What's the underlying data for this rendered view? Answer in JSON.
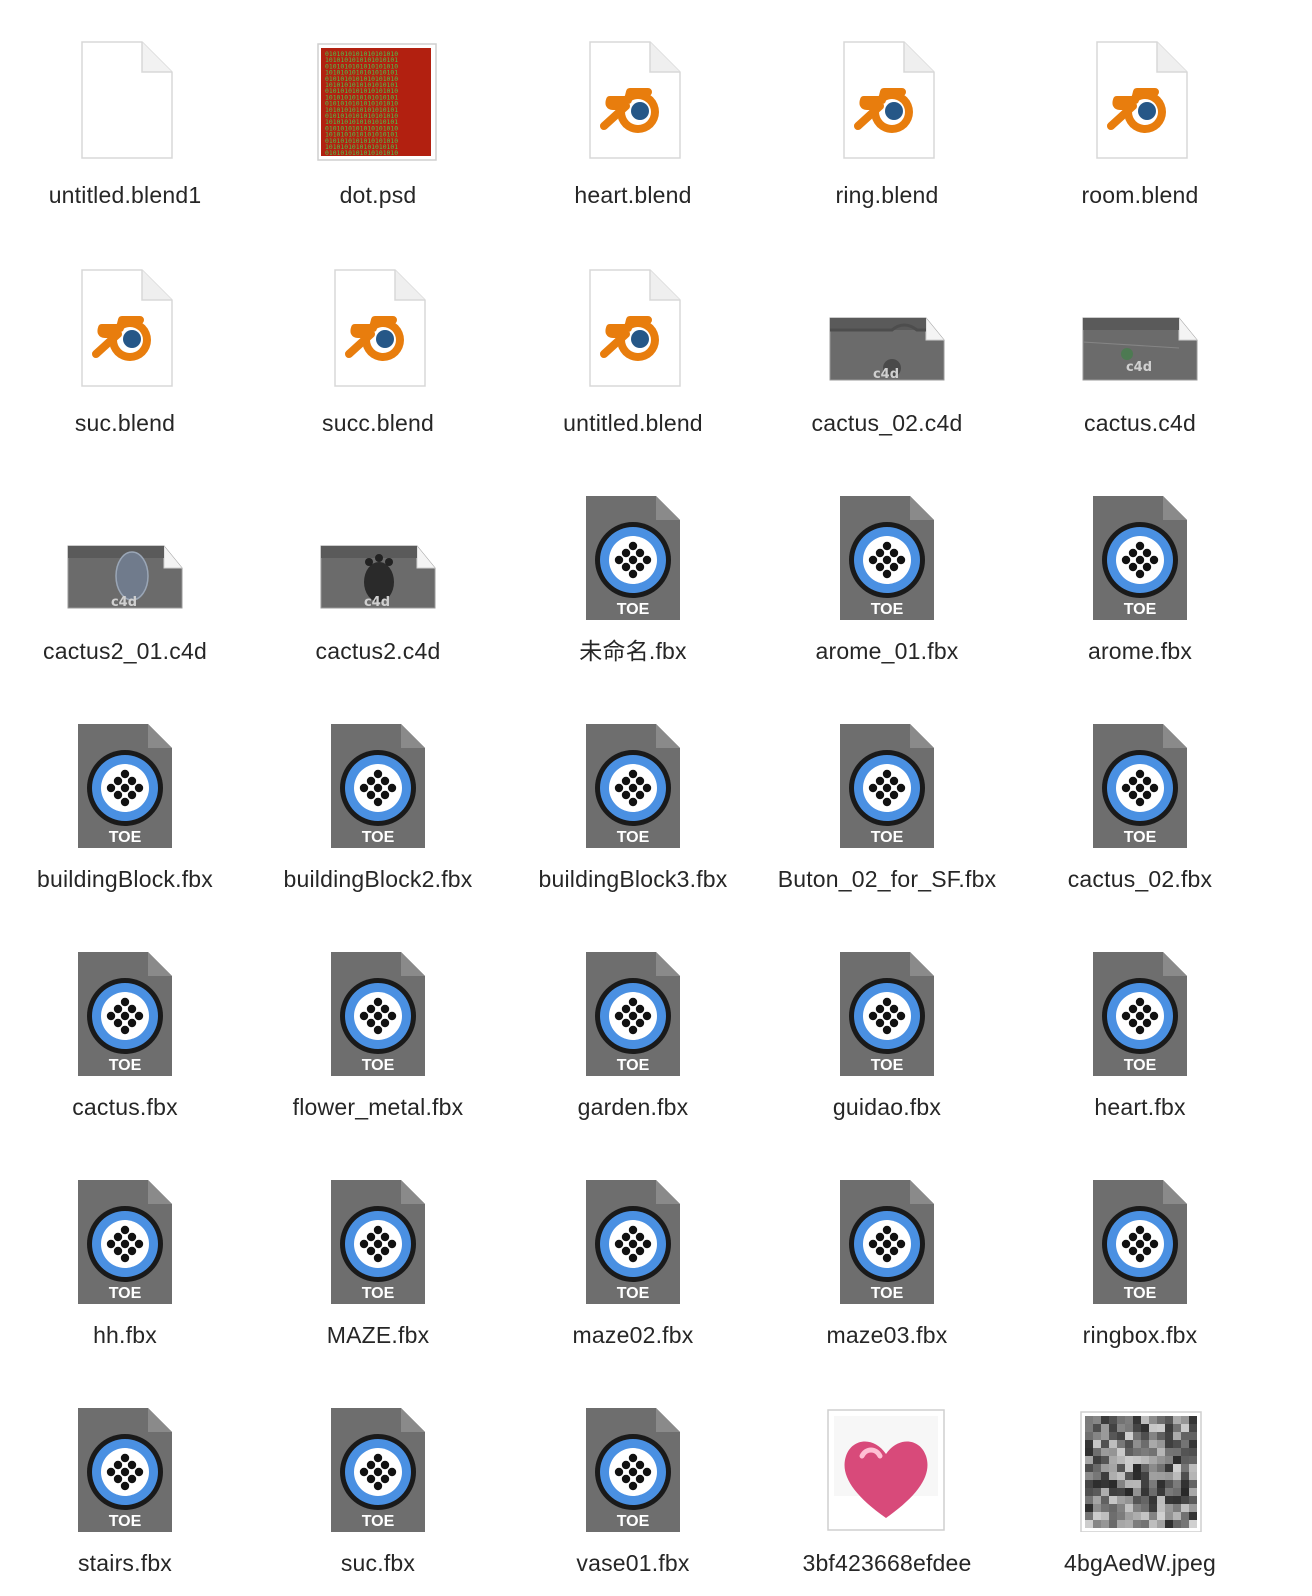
{
  "window": {
    "view": "icon-view"
  },
  "files": [
    {
      "name": "untitled.blend1",
      "icon": "blank-document-icon"
    },
    {
      "name": "dot.psd",
      "icon": "psd-thumbnail-icon"
    },
    {
      "name": "heart.blend",
      "icon": "blender-file-icon"
    },
    {
      "name": "ring.blend",
      "icon": "blender-file-icon"
    },
    {
      "name": "room.blend",
      "icon": "blender-file-icon"
    },
    {
      "name": "suc.blend",
      "icon": "blender-file-icon"
    },
    {
      "name": "succ.blend",
      "icon": "blender-file-icon"
    },
    {
      "name": "untitled.blend",
      "icon": "blender-file-icon"
    },
    {
      "name": "cactus_02.c4d",
      "icon": "c4d-thumbnail-icon",
      "badge": "c4d"
    },
    {
      "name": "cactus.c4d",
      "icon": "c4d-thumbnail-icon",
      "badge": "c4d"
    },
    {
      "name": "cactus2_01.c4d",
      "icon": "c4d-thumbnail-icon",
      "badge": "c4d"
    },
    {
      "name": "cactus2.c4d",
      "icon": "c4d-thumbnail-icon",
      "badge": "c4d"
    },
    {
      "name": "未命名.fbx",
      "icon": "toe-file-icon",
      "badge": "TOE"
    },
    {
      "name": "arome_01.fbx",
      "icon": "toe-file-icon",
      "badge": "TOE"
    },
    {
      "name": "arome.fbx",
      "icon": "toe-file-icon",
      "badge": "TOE"
    },
    {
      "name": "buildingBlock.fbx",
      "icon": "toe-file-icon",
      "badge": "TOE"
    },
    {
      "name": "buildingBlock2.fbx",
      "icon": "toe-file-icon",
      "badge": "TOE"
    },
    {
      "name": "buildingBlock3.fbx",
      "icon": "toe-file-icon",
      "badge": "TOE"
    },
    {
      "name": "Buton_02_for_SF.fbx",
      "icon": "toe-file-icon",
      "badge": "TOE"
    },
    {
      "name": "cactus_02.fbx",
      "icon": "toe-file-icon",
      "badge": "TOE"
    },
    {
      "name": "cactus.fbx",
      "icon": "toe-file-icon",
      "badge": "TOE"
    },
    {
      "name": "flower_metal.fbx",
      "icon": "toe-file-icon",
      "badge": "TOE"
    },
    {
      "name": "garden.fbx",
      "icon": "toe-file-icon",
      "badge": "TOE"
    },
    {
      "name": "guidao.fbx",
      "icon": "toe-file-icon",
      "badge": "TOE"
    },
    {
      "name": "heart.fbx",
      "icon": "toe-file-icon",
      "badge": "TOE"
    },
    {
      "name": "hh.fbx",
      "icon": "toe-file-icon",
      "badge": "TOE"
    },
    {
      "name": "MAZE.fbx",
      "icon": "toe-file-icon",
      "badge": "TOE"
    },
    {
      "name": "maze02.fbx",
      "icon": "toe-file-icon",
      "badge": "TOE"
    },
    {
      "name": "maze03.fbx",
      "icon": "toe-file-icon",
      "badge": "TOE"
    },
    {
      "name": "ringbox.fbx",
      "icon": "toe-file-icon",
      "badge": "TOE"
    },
    {
      "name": "stairs.fbx",
      "icon": "toe-file-icon",
      "badge": "TOE"
    },
    {
      "name": "suc.fbx",
      "icon": "toe-file-icon",
      "badge": "TOE"
    },
    {
      "name": "vase01.fbx",
      "icon": "toe-file-icon",
      "badge": "TOE"
    },
    {
      "name": "3bf423668efdee",
      "icon": "heart-image-thumbnail-icon"
    },
    {
      "name": "4bgAedW.jpeg",
      "icon": "noise-image-thumbnail-icon"
    }
  ],
  "colors": {
    "label_text": "#262626",
    "blender_orange": "#E87D0D",
    "blender_blue": "#265787",
    "toe_doc": "#6E6E6E",
    "toe_ring": "#4A90E2",
    "psd_red": "#B22010",
    "psd_green": "#4CC24C"
  }
}
